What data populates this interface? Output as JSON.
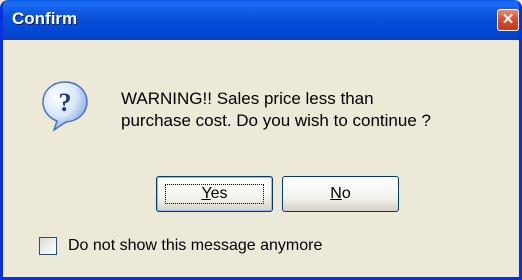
{
  "dialog": {
    "title": "Confirm",
    "message_line1": "WARNING!! Sales price less than",
    "message_line2": "purchase cost. Do you wish to continue ?",
    "icon": "question-icon",
    "close_glyph": "✕"
  },
  "buttons": {
    "yes_label_first": "Y",
    "yes_label_rest": "es",
    "no_label_first": "N",
    "no_label_rest": "o"
  },
  "checkbox": {
    "label": "Do not show this message anymore",
    "checked": false
  },
  "colors": {
    "titlebar": "#0a50d8",
    "window_bg": "#ece9d8",
    "close_button": "#d74a2c"
  }
}
